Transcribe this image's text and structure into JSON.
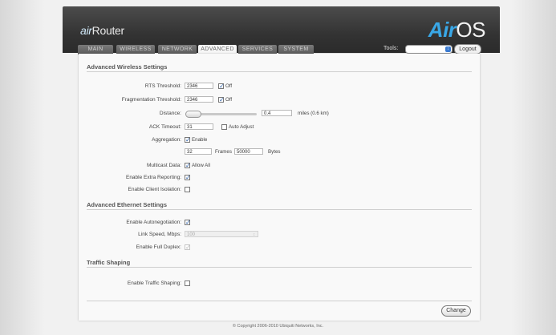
{
  "header": {
    "brand_prefix": "air",
    "brand_rest": "Router",
    "logo_air": "Air",
    "logo_os": "OS"
  },
  "tabs": [
    {
      "label": "MAIN"
    },
    {
      "label": "WIRELESS"
    },
    {
      "label": "NETWORK"
    },
    {
      "label": "ADVANCED"
    },
    {
      "label": "SERVICES"
    },
    {
      "label": "SYSTEM"
    }
  ],
  "active_tab": "ADVANCED",
  "tools": {
    "label": "Tools:",
    "selected": "",
    "logout": "Logout"
  },
  "wireless": {
    "title": "Advanced Wireless Settings",
    "rts": {
      "label": "RTS Threshold:",
      "value": "2346",
      "off_label": "Off",
      "off_checked": true
    },
    "frag": {
      "label": "Fragmentation Threshold:",
      "value": "2346",
      "off_label": "Off",
      "off_checked": true
    },
    "distance": {
      "label": "Distance:",
      "value": "0.4",
      "unit": "miles (0.6 km)",
      "level": 0.02
    },
    "ack": {
      "label": "ACK Timeout:",
      "value": "31",
      "auto_label": "Auto Adjust",
      "auto_checked": false
    },
    "aggregation": {
      "label": "Aggregation:",
      "enable_label": "Enable",
      "checked": true,
      "frames": "32",
      "frames_label": "Frames",
      "bytes": "50000",
      "bytes_label": "Bytes"
    },
    "multicast": {
      "label": "Multicast Data:",
      "allow_label": "Allow All",
      "checked": true
    },
    "extra_reporting": {
      "label": "Enable Extra Reporting:",
      "checked": true
    },
    "client_isolation": {
      "label": "Enable Client Isolation:",
      "checked": false
    }
  },
  "ethernet": {
    "title": "Advanced Ethernet Settings",
    "autoneg": {
      "label": "Enable Autonegotiation:",
      "checked": true
    },
    "link_speed": {
      "label": "Link Speed, Mbps:",
      "value": "100"
    },
    "full_duplex": {
      "label": "Enable Full Duplex:",
      "checked": true
    }
  },
  "shaping": {
    "title": "Traffic Shaping",
    "enable": {
      "label": "Enable Traffic Shaping:",
      "checked": false
    }
  },
  "change_label": "Change",
  "copyright": "© Copyright 2006-2010 Ubiquiti Networks, Inc."
}
